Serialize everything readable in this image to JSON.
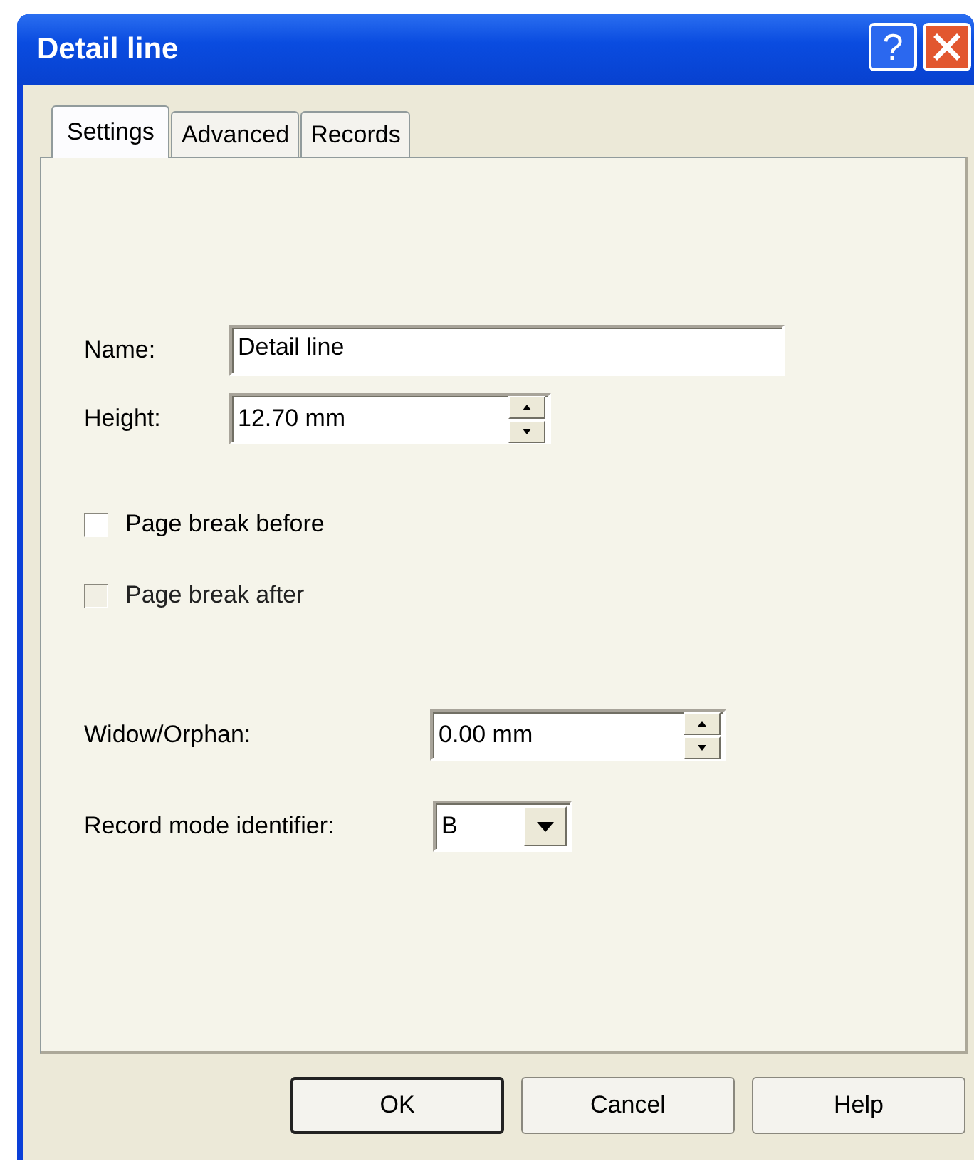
{
  "window": {
    "title": "Detail line",
    "title_buttons": [
      {
        "kind": "help",
        "label": "?"
      },
      {
        "kind": "close"
      }
    ]
  },
  "tabs": [
    {
      "label": "Settings",
      "selected": true
    },
    {
      "label": "Advanced",
      "selected": false
    },
    {
      "label": "Records",
      "selected": false
    }
  ],
  "fields": [
    {
      "kind": "text",
      "label": "Name:",
      "value": "Detail line"
    },
    {
      "kind": "spin",
      "label": "Height:",
      "value": "12.70 mm"
    }
  ],
  "checkboxes": [
    {
      "label": "Page break before",
      "checked": false,
      "disabled": false
    },
    {
      "label": "Page break after",
      "checked": false,
      "disabled": true
    }
  ],
  "fields_2": [
    {
      "kind": "spin",
      "label": "Widow/Orphan:",
      "value": "0.00 mm"
    },
    {
      "kind": "combo",
      "label": "Record mode identifier:",
      "value": "B"
    }
  ],
  "buttons": [
    {
      "label": "OK",
      "default": true
    },
    {
      "label": "Cancel",
      "default": false
    },
    {
      "label": "Help",
      "default": false
    }
  ]
}
